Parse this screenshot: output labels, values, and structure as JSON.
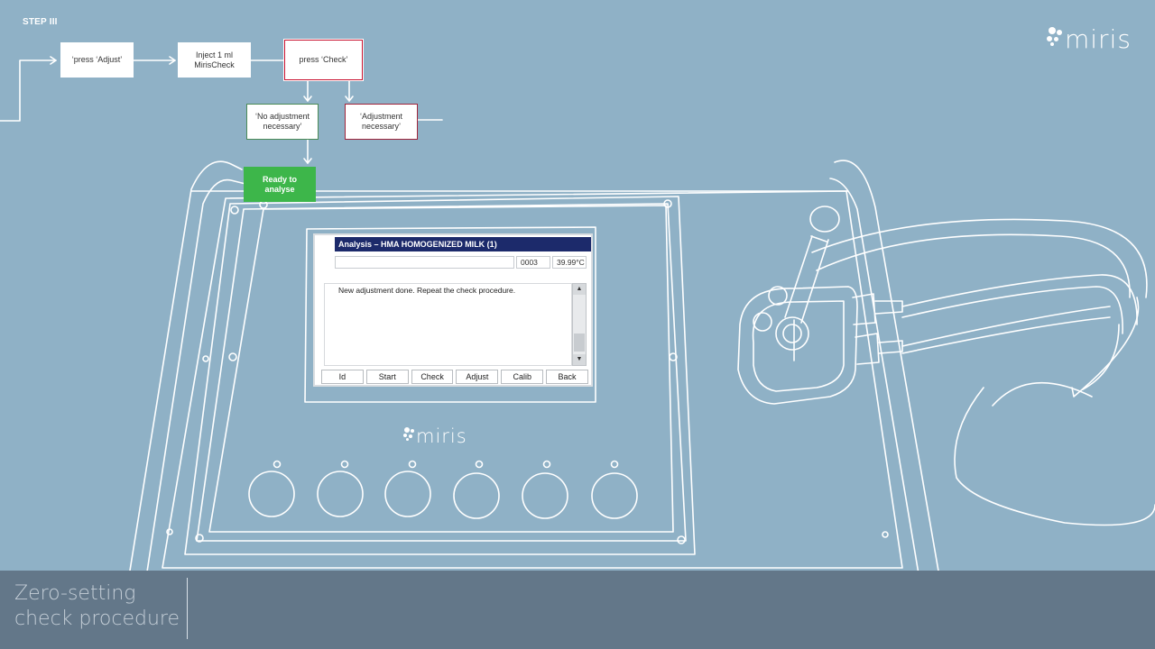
{
  "step": {
    "label": "STEP III"
  },
  "flow": {
    "press_adjust": "‘press ‘Adjust’",
    "inject": "Inject 1 ml MirisCheck",
    "press_check": "press ‘Check’",
    "no_adjustment": "‘No adjustment necessary’",
    "adjustment": "‘Adjustment necessary’",
    "ready": "Ready to analyse"
  },
  "brand": {
    "name": "miris"
  },
  "screen": {
    "title": "Analysis – HMA HOMOGENIZED MILK (1)",
    "field_value": "",
    "sample_no": "0003",
    "temperature": "39.99°C",
    "message": "New adjustment done. Repeat the check procedure.",
    "softkeys": [
      "Id",
      "Start",
      "Check",
      "Adjust",
      "Calib",
      "Back"
    ]
  },
  "caption": {
    "line1": "Zero-setting",
    "line2": "check procedure"
  },
  "colors": {
    "background": "#8fb1c6",
    "accent_red": "#c8102e",
    "ready_green": "#3db64a",
    "screen_header": "#1c2a6b",
    "caption_band": "#637789"
  },
  "icons": {
    "brand_mark": "miris-dots-logo",
    "scroll_up": "arrow-up-icon",
    "scroll_down": "arrow-down-icon"
  }
}
